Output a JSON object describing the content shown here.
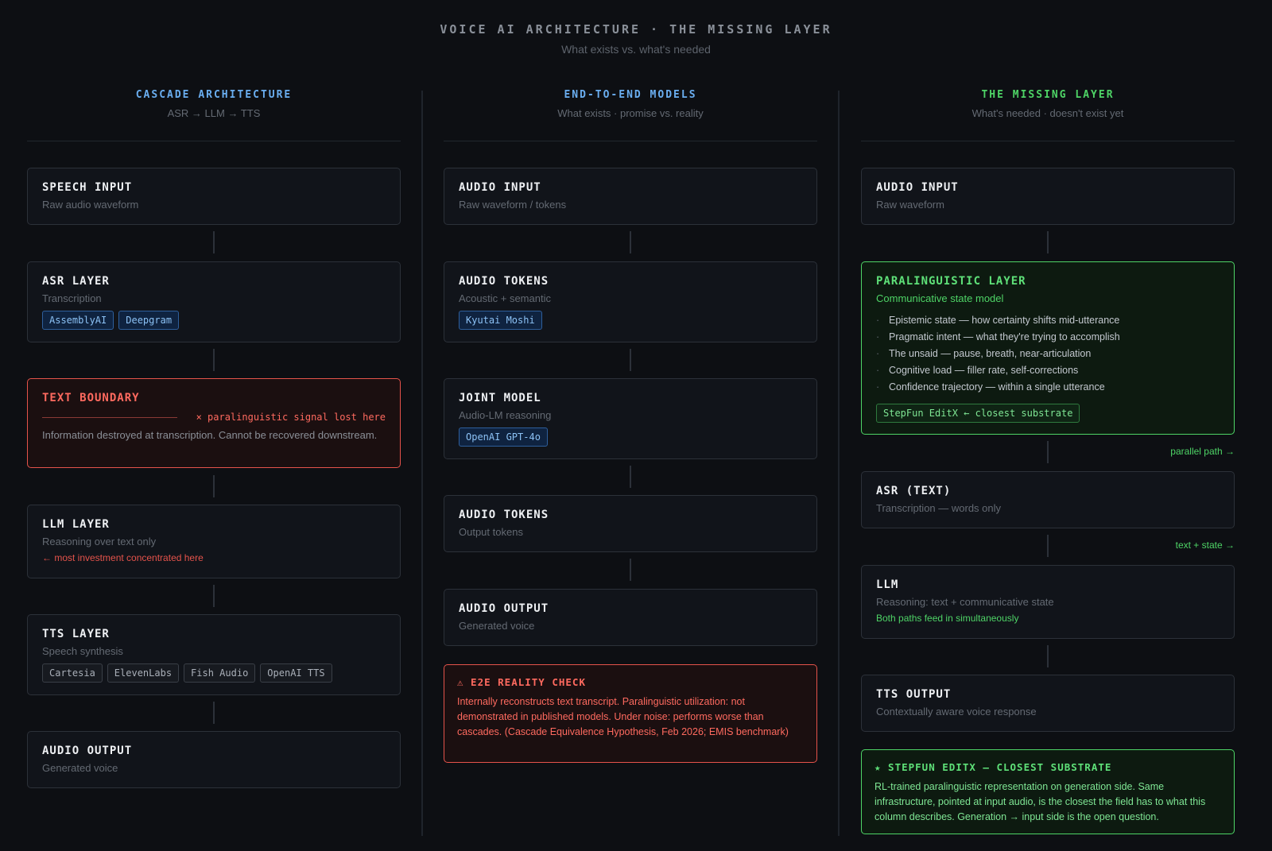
{
  "header": {
    "title": "VOICE AI ARCHITECTURE · THE MISSING LAYER",
    "subtitle": "What exists vs. what's needed"
  },
  "cascade": {
    "title": "CASCADE ARCHITECTURE",
    "subtitle": "ASR → LLM → TTS",
    "speech_input": {
      "title": "SPEECH INPUT",
      "sub": "Raw audio waveform"
    },
    "asr": {
      "title": "ASR LAYER",
      "sub": "Transcription",
      "chips": [
        "AssemblyAI",
        "Deepgram"
      ]
    },
    "boundary": {
      "title": "TEXT BOUNDARY",
      "lost": "× paralinguistic signal lost here",
      "desc": "Information destroyed at transcription. Cannot be recovered downstream."
    },
    "llm": {
      "title": "LLM LAYER",
      "sub": "Reasoning over text only",
      "note": "← most investment concentrated here"
    },
    "tts": {
      "title": "TTS LAYER",
      "sub": "Speech synthesis",
      "chips": [
        "Cartesia",
        "ElevenLabs",
        "Fish Audio",
        "OpenAI TTS"
      ]
    },
    "audio_output": {
      "title": "AUDIO OUTPUT",
      "sub": "Generated voice"
    }
  },
  "e2e": {
    "title": "END-TO-END MODELS",
    "subtitle": "What exists · promise vs. reality",
    "audio_input": {
      "title": "AUDIO INPUT",
      "sub": "Raw waveform / tokens"
    },
    "audio_tokens_in": {
      "title": "AUDIO TOKENS",
      "sub": "Acoustic + semantic",
      "chips": [
        "Kyutai Moshi"
      ]
    },
    "joint": {
      "title": "JOINT MODEL",
      "sub": "Audio-LM reasoning",
      "chips": [
        "OpenAI GPT-4o"
      ]
    },
    "audio_tokens_out": {
      "title": "AUDIO TOKENS",
      "sub": "Output tokens"
    },
    "audio_output": {
      "title": "AUDIO OUTPUT",
      "sub": "Generated voice"
    },
    "reality": {
      "title": "⚠ E2E REALITY CHECK",
      "body": "Internally reconstructs text transcript. Paralinguistic utilization: not demonstrated in published models. Under noise: performs worse than cascades. (Cascade Equivalence Hypothesis, Feb 2026; EMIS benchmark)"
    }
  },
  "missing": {
    "title": "THE MISSING LAYER",
    "subtitle": "What's needed · doesn't exist yet",
    "audio_input": {
      "title": "AUDIO INPUT",
      "sub": "Raw waveform"
    },
    "paralinguistic": {
      "title": "PARALINGUISTIC LAYER",
      "sub": "Communicative state model",
      "bullets": [
        "Epistemic state — how certainty shifts mid-utterance",
        "Pragmatic intent — what they're trying to accomplish",
        "The unsaid — pause, breath, near-articulation",
        "Cognitive load — filler rate, self-corrections",
        "Confidence trajectory — within a single utterance"
      ],
      "chip": "StepFun EditX ← closest substrate"
    },
    "parallel_note": "parallel path →",
    "asr": {
      "title": "ASR (TEXT)",
      "sub": "Transcription — words only"
    },
    "text_state_note": "text + state →",
    "llm": {
      "title": "LLM",
      "sub": "Reasoning: text + communicative state",
      "note": "Both paths feed in simultaneously"
    },
    "tts": {
      "title": "TTS OUTPUT",
      "sub": "Contextually aware voice response"
    },
    "stepfun": {
      "title": "★ STEPFUN EDITX — CLOSEST SUBSTRATE",
      "body": "RL-trained paralinguistic representation on generation side. Same infrastructure, pointed at input audio, is the closest the field has to what this column describes. Generation → input side is the open question."
    }
  }
}
